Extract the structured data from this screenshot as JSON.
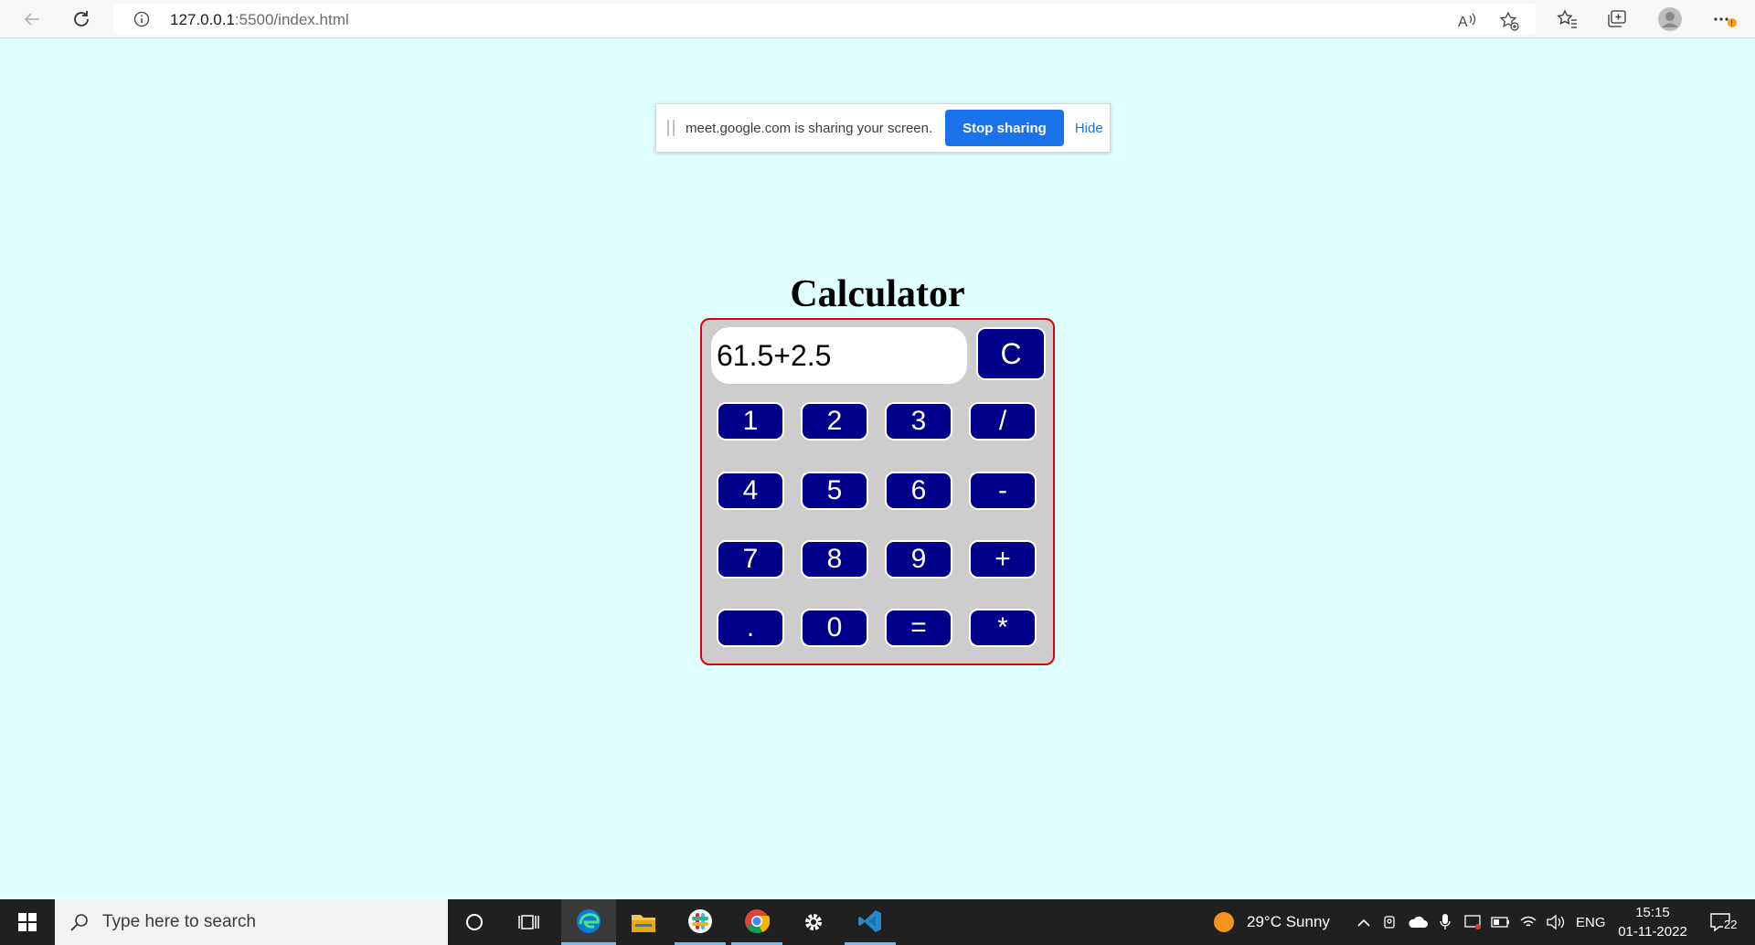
{
  "browser": {
    "url_host": "127.0.0.1",
    "url_path": ":5500/index.html",
    "icons": [
      "back-icon",
      "refresh-icon",
      "info-icon",
      "read-aloud-icon",
      "add-favorite-icon",
      "favorites-icon",
      "collections-icon",
      "profile-icon",
      "more-icon"
    ]
  },
  "share_banner": {
    "message": "meet.google.com is sharing your screen.",
    "stop_label": "Stop sharing",
    "hide_label": "Hide"
  },
  "calculator": {
    "title": "Calculator",
    "display_value": "61.5+2.5",
    "clear_label": "C",
    "keys": [
      "1",
      "2",
      "3",
      "/",
      "4",
      "5",
      "6",
      "-",
      "7",
      "8",
      "9",
      "+",
      ".",
      "0",
      "=",
      "*"
    ],
    "accent_color": "#00008b",
    "border_color": "#e0000a"
  },
  "taskbar": {
    "search_placeholder": "Type here to search",
    "weather": "29°C  Sunny",
    "language": "ENG",
    "time": "15:15",
    "date": "01-11-2022",
    "notifications": "22",
    "apps": [
      "cortana-icon",
      "task-view-icon",
      "edge-icon",
      "file-explorer-icon",
      "slack-icon",
      "chrome-icon",
      "settings-icon",
      "vscode-icon"
    ]
  }
}
